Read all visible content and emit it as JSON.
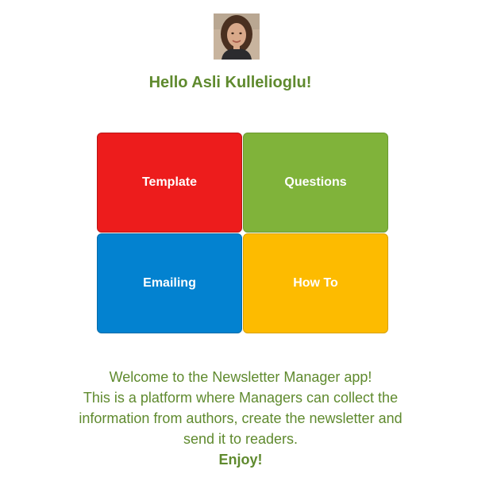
{
  "user": {
    "greeting": "Hello Asli Kullelioglu!"
  },
  "tiles": [
    {
      "label": "Template",
      "color": "#ed1c1c"
    },
    {
      "label": "Questions",
      "color": "#80b33a"
    },
    {
      "label": "Emailing",
      "color": "#0382d0"
    },
    {
      "label": "How To",
      "color": "#fdbb00"
    }
  ],
  "welcome": {
    "lines": [
      "Welcome to the Newsletter Manager app!",
      "This is a platform where Managers can collect the",
      "information from authors, create the newsletter and",
      "send it to readers."
    ],
    "enjoy": "Enjoy!"
  },
  "colors": {
    "text_green": "#5f8a2e"
  }
}
